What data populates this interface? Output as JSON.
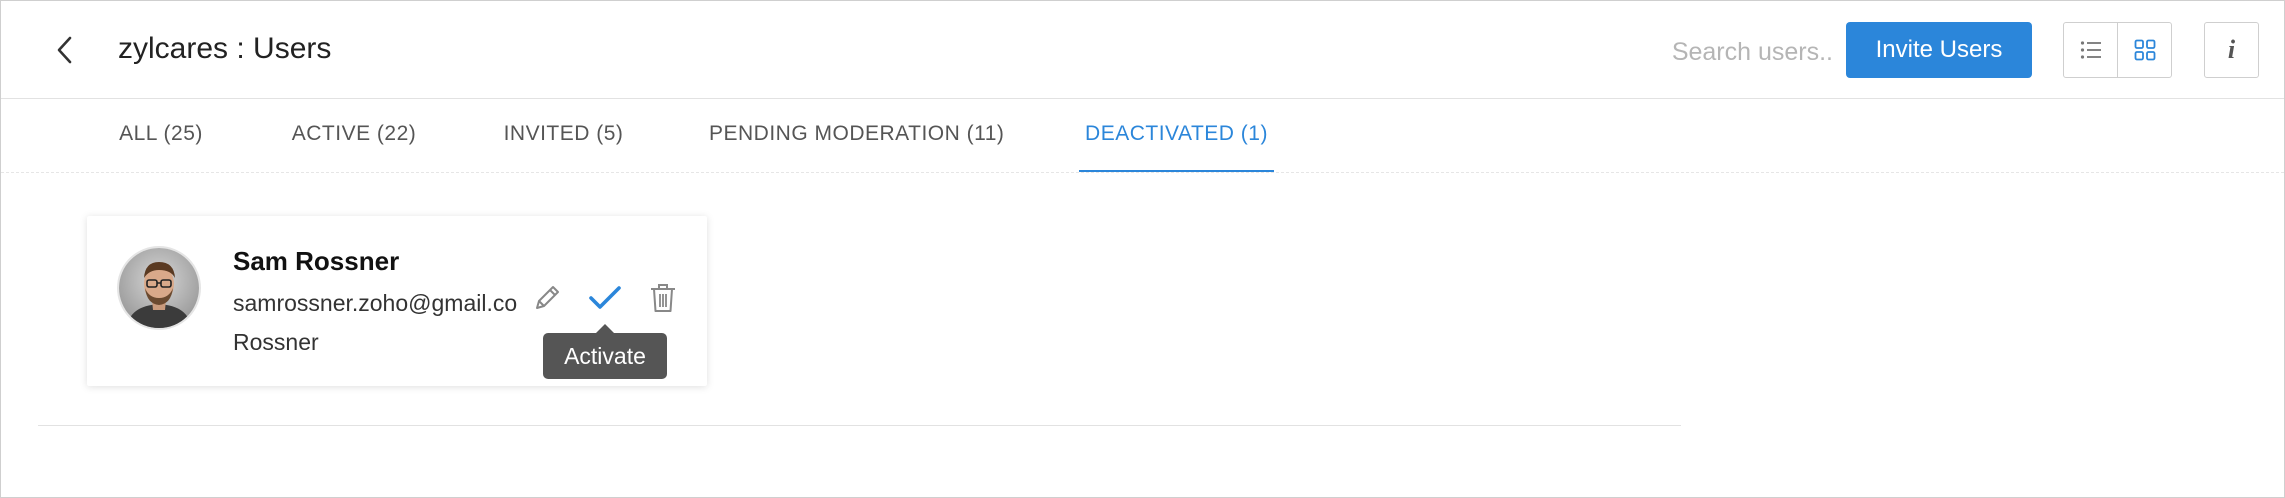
{
  "header": {
    "title": "zylcares : Users",
    "search_placeholder": "Search users..",
    "search_value": "",
    "invite_label": "Invite Users",
    "info_label": "i"
  },
  "icons": {
    "back": "chevron-left-icon",
    "list_view": "list-view-icon",
    "grid_view": "grid-view-icon",
    "info": "info-icon",
    "edit": "pencil-icon",
    "activate": "checkmark-icon",
    "delete": "trash-icon"
  },
  "colors": {
    "accent": "#2b86da",
    "tooltip_bg": "#555555"
  },
  "tabs": [
    {
      "label": "ALL (25)",
      "active": false
    },
    {
      "label": "ACTIVE (22)",
      "active": false
    },
    {
      "label": "INVITED (5)",
      "active": false
    },
    {
      "label": "PENDING MODERATION (11)",
      "active": false
    },
    {
      "label": "DEACTIVATED (1)",
      "active": true
    }
  ],
  "users": [
    {
      "name": "Sam Rossner",
      "email": "samrossner.zoho@gmail.co",
      "surname": "Rossner",
      "tooltip": "Activate"
    }
  ]
}
